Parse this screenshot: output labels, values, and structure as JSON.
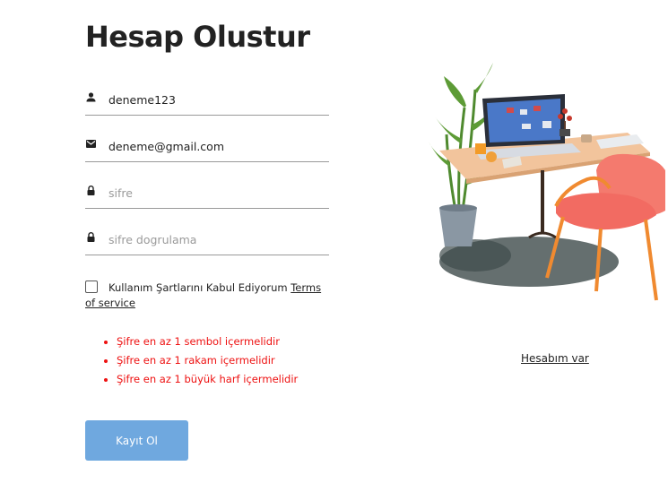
{
  "page": {
    "title": "Hesap Olustur"
  },
  "form": {
    "username": {
      "value": "deneme123",
      "icon": "person-icon"
    },
    "email": {
      "value": "deneme@gmail.com",
      "icon": "mail-icon"
    },
    "password": {
      "placeholder": "sifre",
      "icon": "lock-icon"
    },
    "password_confirm": {
      "placeholder": "sifre dogrulama",
      "icon": "lock-icon"
    },
    "terms": {
      "checked": false,
      "label": "Kullanım Şartlarını Kabul Ediyorum",
      "link": "Terms of service"
    },
    "errors": [
      "Şifre en az 1 sembol içermelidir",
      "Şifre en az 1 rakam içermelidir",
      "Şifre en az 1 büyük harf içermelidir"
    ],
    "submit_label": "Kayıt Ol"
  },
  "login_link": "Hesabım var",
  "colors": {
    "accent": "#6fa8df",
    "error": "#ee1111",
    "chair": "#f47a6e",
    "chair_legs": "#f08a30"
  }
}
